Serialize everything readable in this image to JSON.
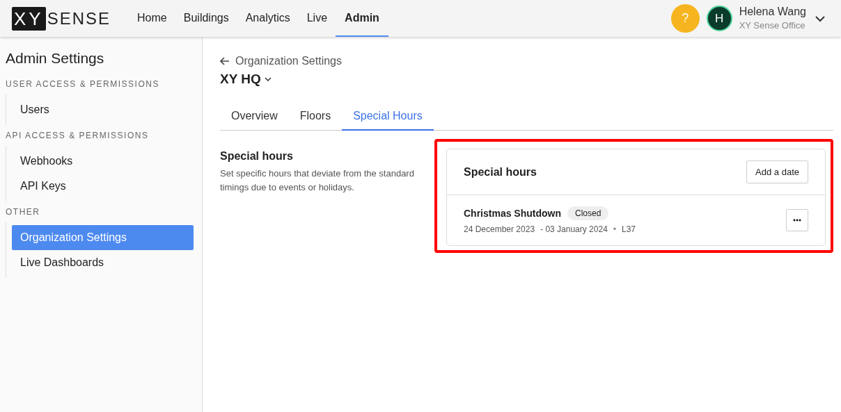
{
  "logo": {
    "boxed": "XY",
    "text": "SENSE"
  },
  "nav": [
    {
      "label": "Home",
      "selected": false
    },
    {
      "label": "Buildings",
      "selected": false
    },
    {
      "label": "Analytics",
      "selected": false
    },
    {
      "label": "Live",
      "selected": false
    },
    {
      "label": "Admin",
      "selected": true
    }
  ],
  "help": {
    "label": "?"
  },
  "user": {
    "initial": "H",
    "name": "Helena Wang",
    "org": "XY Sense Office"
  },
  "sidebar": {
    "title": "Admin Settings",
    "groups": [
      {
        "heading": "USER ACCESS & PERMISSIONS",
        "items": [
          {
            "label": "Users",
            "selected": false
          }
        ]
      },
      {
        "heading": "API ACCESS & PERMISSIONS",
        "items": [
          {
            "label": "Webhooks",
            "selected": false
          },
          {
            "label": "API Keys",
            "selected": false
          }
        ]
      },
      {
        "heading": "OTHER",
        "items": [
          {
            "label": "Organization Settings",
            "selected": true
          },
          {
            "label": "Live Dashboards",
            "selected": false
          }
        ]
      }
    ]
  },
  "breadcrumb": "Organization Settings",
  "building": "XY HQ",
  "tabs": [
    {
      "label": "Overview",
      "selected": false
    },
    {
      "label": "Floors",
      "selected": false
    },
    {
      "label": "Special Hours",
      "selected": true
    }
  ],
  "section": {
    "title": "Special hours",
    "description": "Set specific hours that deviate from the standard timings due to events or holidays."
  },
  "card": {
    "title": "Special hours",
    "highlighted": true,
    "add_button": "Add a date",
    "entries": [
      {
        "name": "Christmas Shutdown",
        "status": "Closed",
        "start": "24 December 2023",
        "end": "- 03 January 2024",
        "separator": "•",
        "floor": "L37"
      }
    ]
  }
}
